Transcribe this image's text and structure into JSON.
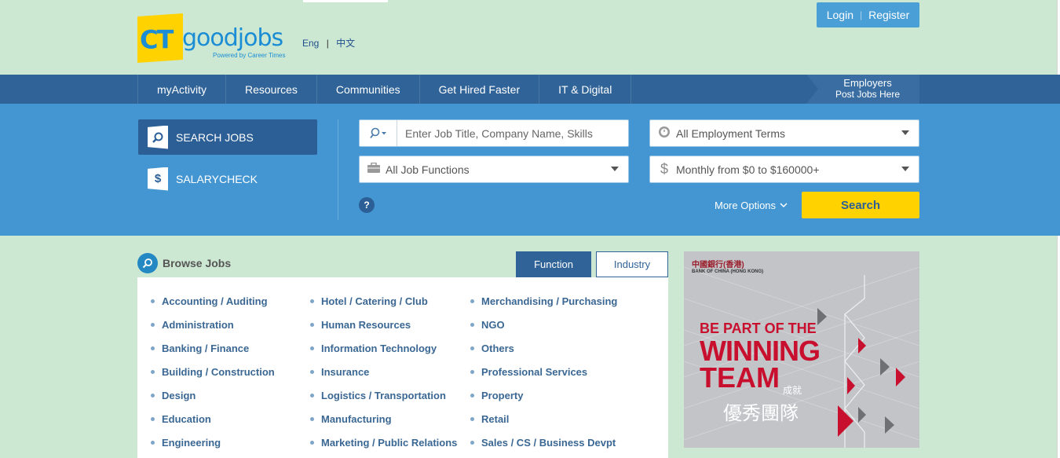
{
  "header": {
    "logo_ct": "CT",
    "logo_word": "goodjobs",
    "logo_tagline": "Powered by Career Times",
    "lang_en": "Eng",
    "lang_sep": "|",
    "lang_zh": "中文",
    "login": "Login",
    "auth_sep": "|",
    "register": "Register"
  },
  "nav": {
    "items": [
      "myActivity",
      "Resources",
      "Communities",
      "Get Hired Faster",
      "IT & Digital"
    ],
    "employers_line1": "Employers",
    "employers_line2": "Post Jobs Here"
  },
  "search": {
    "search_jobs_label": "SEARCH JOBS",
    "salarycheck_label": "SALARYCHECK",
    "keyword_placeholder": "Enter Job Title, Company Name, Skills",
    "employment_terms": "All Employment Terms",
    "job_functions": "All Job Functions",
    "salary": "Monthly from $0 to $160000+",
    "help": "?",
    "more_options": "More Options",
    "search_button": "Search"
  },
  "browse": {
    "title": "Browse Jobs",
    "tab_function": "Function",
    "tab_industry": "Industry",
    "columns": [
      [
        "Accounting / Auditing",
        "Administration",
        "Banking / Finance",
        "Building / Construction",
        "Design",
        "Education",
        "Engineering"
      ],
      [
        "Hotel / Catering / Club",
        "Human Resources",
        "Information Technology",
        "Insurance",
        "Logistics / Transportation",
        "Manufacturing",
        "Marketing / Public Relations"
      ],
      [
        "Merchandising / Purchasing",
        "NGO",
        "Others",
        "Professional Services",
        "Property",
        "Retail",
        "Sales / CS / Business Devpt"
      ]
    ]
  },
  "ad": {
    "bank_name": "中國銀行(香港)",
    "bank_sub": "BANK OF CHINA (HONG KONG)",
    "line1": "BE PART OF THE",
    "line2": "WINNING",
    "line3": "TEAM",
    "zh1": "成就",
    "zh2": "優秀團隊"
  },
  "colors": {
    "page_bg": "#cde8d2",
    "nav_bg": "#306398",
    "search_bg": "#4496d2",
    "accent_yellow": "#ffd200",
    "link_blue": "#3a6793",
    "ad_red": "#c8102e"
  }
}
